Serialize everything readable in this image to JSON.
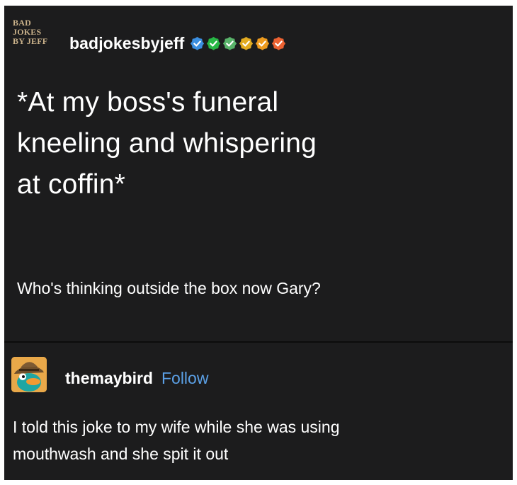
{
  "post": {
    "blog_logo_lines": [
      "BAD",
      "JOKES",
      "BY JEFF"
    ],
    "author": "badjokesbyjeff",
    "badges": [
      {
        "name": "verified-badge",
        "color": "#3b8fe0"
      },
      {
        "name": "badge-green",
        "color": "#27b845"
      },
      {
        "name": "badge-teal",
        "color": "#59b36a"
      },
      {
        "name": "badge-yellow",
        "color": "#e2ab21"
      },
      {
        "name": "badge-orange",
        "color": "#ee9b1e"
      },
      {
        "name": "badge-red",
        "color": "#ec6232"
      }
    ],
    "headline_lines": [
      "*At my boss's funeral",
      "kneeling and whispering",
      "at coffin*"
    ],
    "body": "Who's thinking outside the box now Gary?"
  },
  "reply": {
    "avatar_icon": "platypus-avatar-icon",
    "username": "themaybird",
    "follow_label": "Follow",
    "text_lines": [
      "I told this joke to my wife while she was using",
      "mouthwash and she spit it out"
    ]
  },
  "colors": {
    "background": "#1c1c1d",
    "text": "#ffffff",
    "link": "#5ba0e6",
    "logo": "#c9b18a"
  }
}
